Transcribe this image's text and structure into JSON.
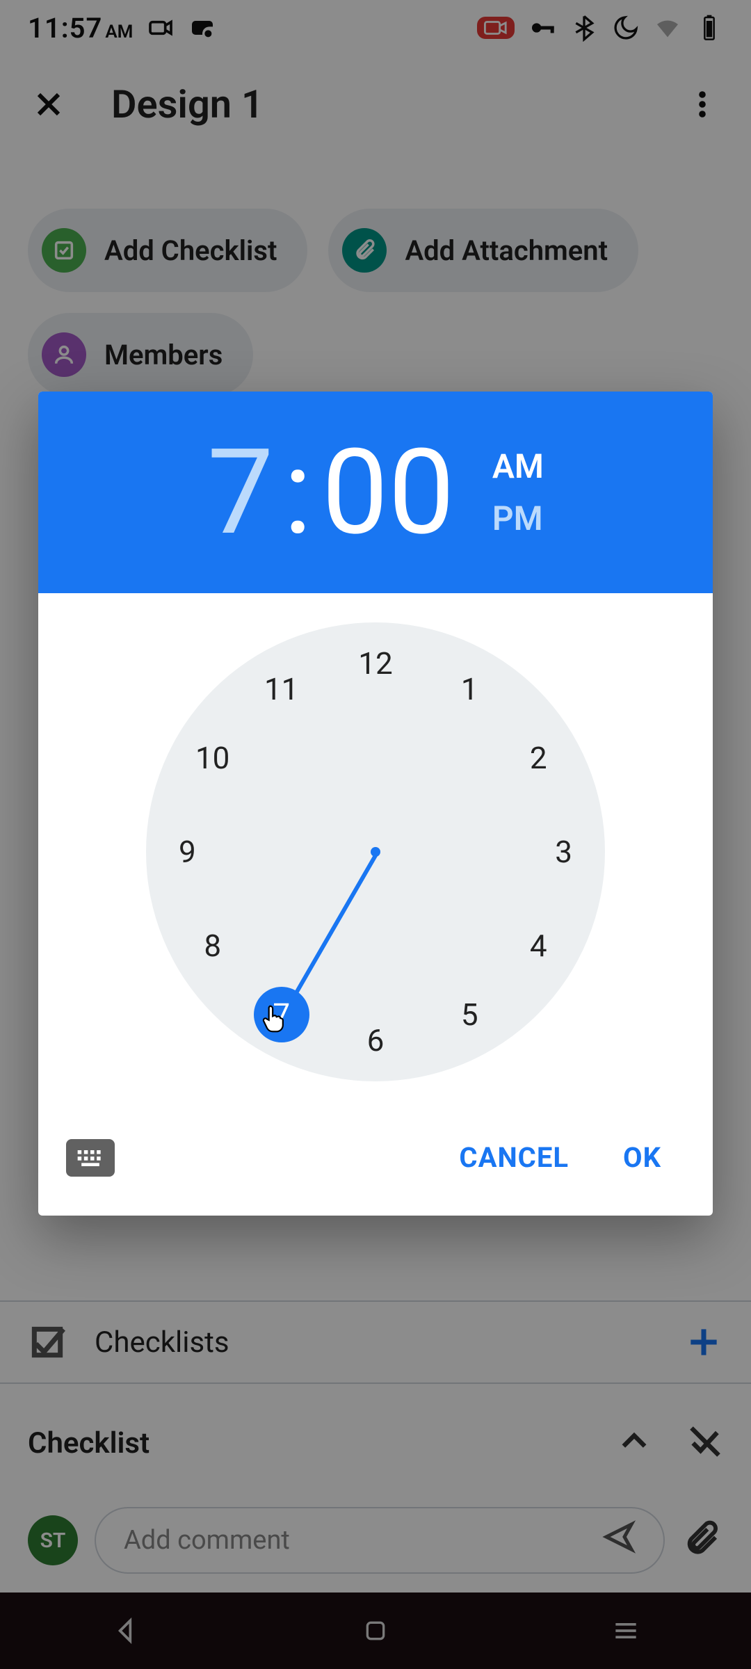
{
  "status_bar": {
    "time": "11:57",
    "ampm": "AM"
  },
  "header": {
    "title": "Design 1"
  },
  "chips": {
    "checklist_label": "Add Checklist",
    "attachment_label": "Add Attachment",
    "members_label": "Members"
  },
  "time_picker": {
    "hour": "7",
    "minute": "00",
    "am_label": "AM",
    "pm_label": "PM",
    "period": "AM",
    "selected_hour": 7,
    "hours": [
      "12",
      "1",
      "2",
      "3",
      "4",
      "5",
      "6",
      "7",
      "8",
      "9",
      "10",
      "11"
    ],
    "cancel_label": "CANCEL",
    "ok_label": "OK"
  },
  "checklists_section": {
    "title": "Checklists",
    "item_label": "Checklist"
  },
  "comment": {
    "avatar_initials": "ST",
    "placeholder": "Add comment"
  },
  "colors": {
    "accent": "#1976f2"
  }
}
